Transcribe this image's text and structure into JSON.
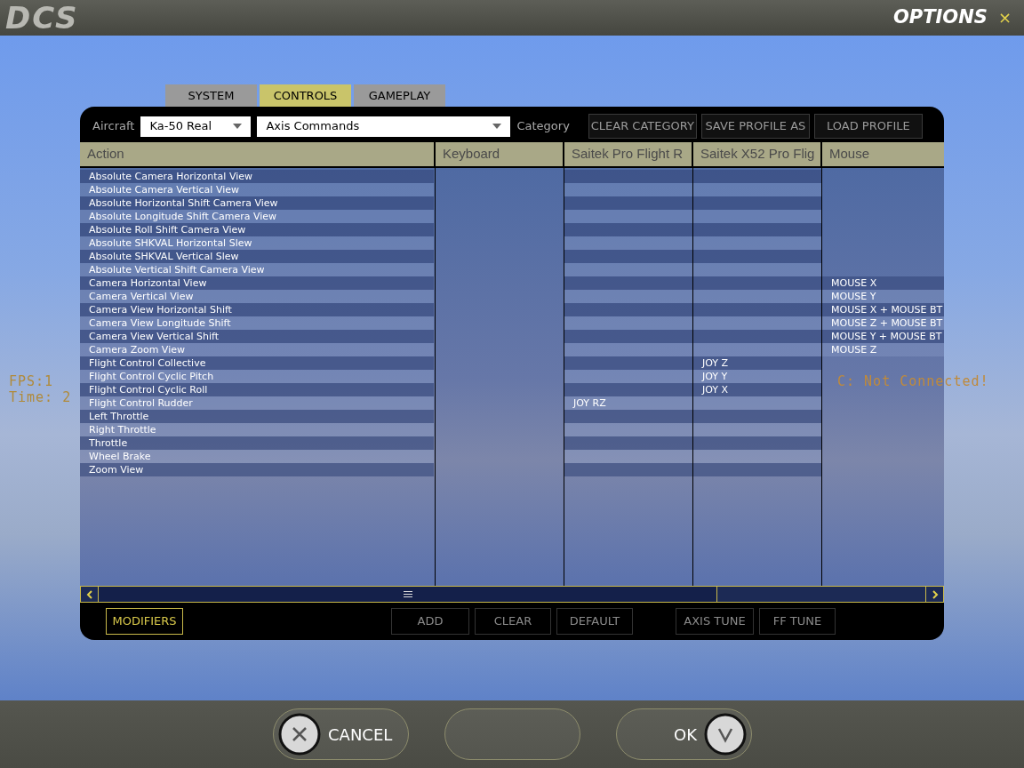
{
  "header": {
    "logo": "DCS",
    "title": "OPTIONS",
    "close": "×"
  },
  "overlay": {
    "fps": "FPS:1",
    "time": "Time: 2",
    "connection": "C: Not Connected!"
  },
  "tabs": [
    {
      "label": "SYSTEM",
      "selected": false
    },
    {
      "label": "CONTROLS",
      "selected": true
    },
    {
      "label": "GAMEPLAY",
      "selected": false
    }
  ],
  "toolbar": {
    "aircraft_label": "Aircraft",
    "aircraft": "Ka-50 Real",
    "commands": "Axis Commands",
    "category_label": "Category",
    "buttons": [
      "CLEAR CATEGORY",
      "SAVE PROFILE AS",
      "LOAD PROFILE"
    ]
  },
  "table": {
    "columns": [
      {
        "label": "Action"
      },
      {
        "label": "Keyboard"
      },
      {
        "label": "Saitek Pro Flight R"
      },
      {
        "label": "Saitek X52 Pro Flig"
      },
      {
        "label": "Mouse"
      }
    ],
    "rows": [
      {
        "action": "Absolute Camera Horizontal View"
      },
      {
        "action": "Absolute Camera Vertical View"
      },
      {
        "action": "Absolute Horizontal Shift Camera View"
      },
      {
        "action": "Absolute Longitude Shift Camera View"
      },
      {
        "action": "Absolute Roll Shift Camera View"
      },
      {
        "action": "Absolute SHKVAL Horizontal Slew"
      },
      {
        "action": "Absolute SHKVAL Vertical Slew"
      },
      {
        "action": "Absolute Vertical Shift Camera View"
      },
      {
        "action": "Camera Horizontal View",
        "mouse": "MOUSE X"
      },
      {
        "action": "Camera Vertical View",
        "mouse": "MOUSE Y"
      },
      {
        "action": "Camera View Horizontal Shift",
        "mouse": "MOUSE X + MOUSE BT"
      },
      {
        "action": "Camera View Longitude Shift",
        "mouse": "MOUSE Z + MOUSE BT"
      },
      {
        "action": "Camera View Vertical Shift",
        "mouse": "MOUSE Y + MOUSE BT"
      },
      {
        "action": "Camera Zoom View",
        "mouse": "MOUSE Z"
      },
      {
        "action": "Flight Control Collective",
        "saitek_x52": "JOY Z"
      },
      {
        "action": "Flight Control Cyclic Pitch",
        "saitek_x52": "JOY Y"
      },
      {
        "action": "Flight Control Cyclic Roll",
        "saitek_x52": "JOY X"
      },
      {
        "action": "Flight Control Rudder",
        "saitek_pro": "JOY RZ"
      },
      {
        "action": "Left Throttle"
      },
      {
        "action": "Right Throttle"
      },
      {
        "action": "Throttle"
      },
      {
        "action": "Wheel Brake"
      },
      {
        "action": "Zoom View"
      }
    ]
  },
  "actions": [
    {
      "label": "MODIFIERS",
      "highlighted": true
    },
    {
      "label": "ADD",
      "highlighted": false
    },
    {
      "label": "CLEAR",
      "highlighted": false
    },
    {
      "label": "DEFAULT",
      "highlighted": false
    },
    {
      "label": "AXIS TUNE",
      "highlighted": false
    },
    {
      "label": "FF TUNE",
      "highlighted": false
    }
  ],
  "footer": {
    "cancel": "CANCEL",
    "ok": "OK"
  }
}
